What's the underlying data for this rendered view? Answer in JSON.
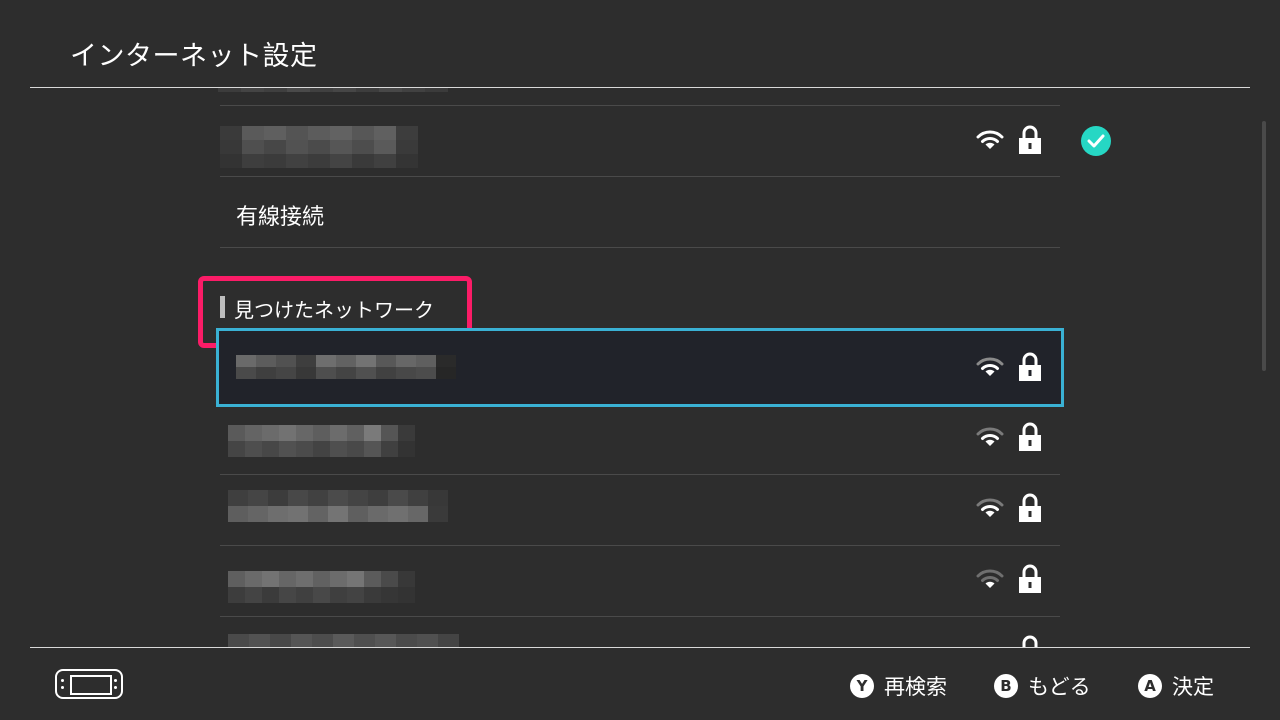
{
  "header": {
    "title": "インターネット設定"
  },
  "networks": {
    "wired_label": "有線接続",
    "section_label": "見つけたネットワーク"
  },
  "icons": {
    "wifi": "wifi-signal-icon",
    "lock": "lock-icon",
    "connected": "check-icon",
    "device": "handheld-console-icon"
  },
  "colors": {
    "background": "#2d2d2d",
    "selection_border": "#3ab1d4",
    "highlight_annotation": "#fb1c67",
    "connected_check": "#26d7c4"
  },
  "footer": {
    "hints": [
      {
        "key": "Y",
        "label": "再検索"
      },
      {
        "key": "B",
        "label": "もどる"
      },
      {
        "key": "A",
        "label": "決定"
      }
    ]
  }
}
